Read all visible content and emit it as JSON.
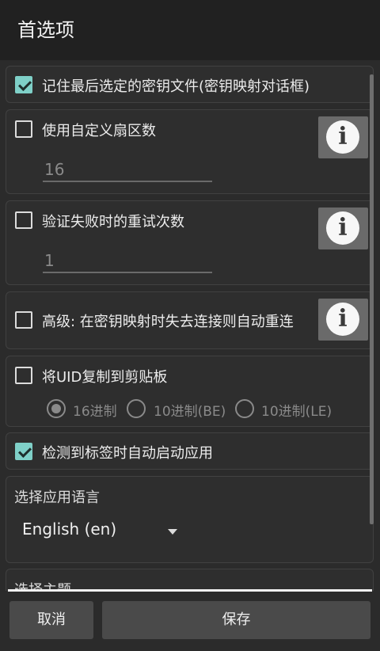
{
  "title": "首选项",
  "preferences": {
    "remember_key": {
      "label": "记住最后选定的密钥文件(密钥映射对话框)",
      "checked": true
    },
    "custom_sectors": {
      "label": "使用自定义扇区数",
      "checked": false,
      "value": "16",
      "info_icon": "info-icon"
    },
    "retry_count": {
      "label": "验证失败时的重试次数",
      "checked": false,
      "value": "1",
      "info_icon": "info-icon"
    },
    "auto_reconnect": {
      "label": "高级: 在密钥映射时失去连接则自动重连",
      "checked": false,
      "info_icon": "info-icon"
    },
    "copy_uid": {
      "label": "将UID复制到剪贴板",
      "checked": false,
      "options": [
        "16进制",
        "10进制(BE)",
        "10进制(LE)"
      ],
      "selected": "16进制"
    },
    "auto_start": {
      "label": "检测到标签时自动启动应用",
      "checked": true
    },
    "language": {
      "title": "选择应用语言",
      "selected": "English (en)"
    },
    "theme": {
      "title": "选择主题"
    }
  },
  "buttons": {
    "cancel": "取消",
    "save": "保存"
  },
  "colors": {
    "checkbox_accent": "#7fd0c8",
    "background": "#2b2b2b",
    "titlebar": "#212121"
  }
}
